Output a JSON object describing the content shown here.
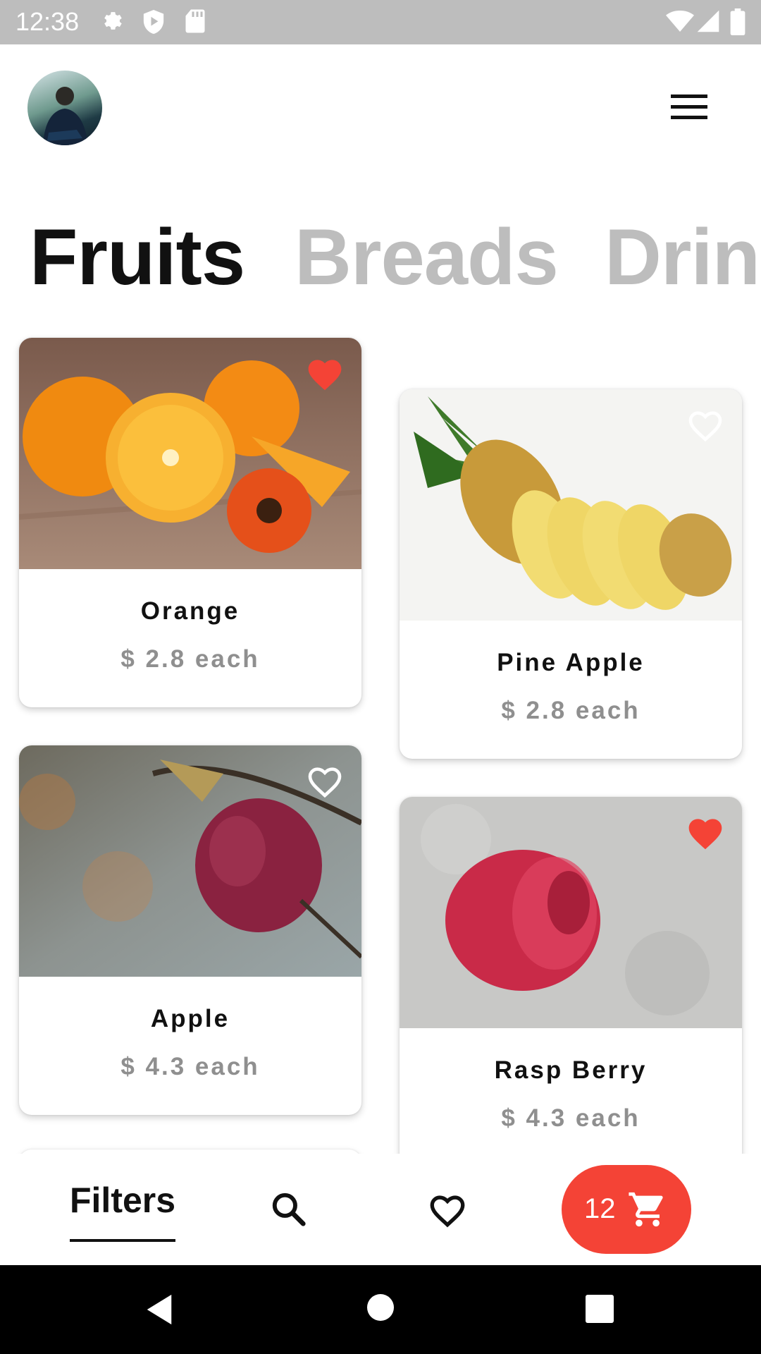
{
  "status_bar": {
    "time": "12:38",
    "left_icons": [
      "gear-icon",
      "shield-play-icon",
      "sd-card-icon"
    ],
    "right_icons": [
      "wifi-icon",
      "cellular-signal-icon",
      "battery-icon"
    ]
  },
  "header": {
    "avatar": "user-avatar",
    "menu_icon": "hamburger-menu-icon"
  },
  "categories": [
    {
      "label": "Fruits",
      "active": true
    },
    {
      "label": "Breads",
      "active": false
    },
    {
      "label": "Drinl",
      "active": false
    }
  ],
  "products": [
    {
      "name": "Orange",
      "price": "$ 2.8 each",
      "favorited": true
    },
    {
      "name": "Pine Apple",
      "price": "$ 2.8 each",
      "favorited": false
    },
    {
      "name": "Apple",
      "price": "$ 4.3 each",
      "favorited": false
    },
    {
      "name": "Rasp Berry",
      "price": "$ 4.3 each",
      "favorited": true
    }
  ],
  "bottom_nav": {
    "filters_label": "Filters",
    "search_icon": "search-icon",
    "favorites_icon": "heart-outline-icon",
    "cart_count": "12",
    "cart_icon": "shopping-cart-icon"
  },
  "system_nav": [
    "back-icon",
    "home-icon",
    "recents-icon"
  ],
  "colors": {
    "accent": "#f44336",
    "status_bar": "#bdbdbd",
    "inactive_category": "#bdbdbd",
    "price_text": "#8f8f8f"
  }
}
